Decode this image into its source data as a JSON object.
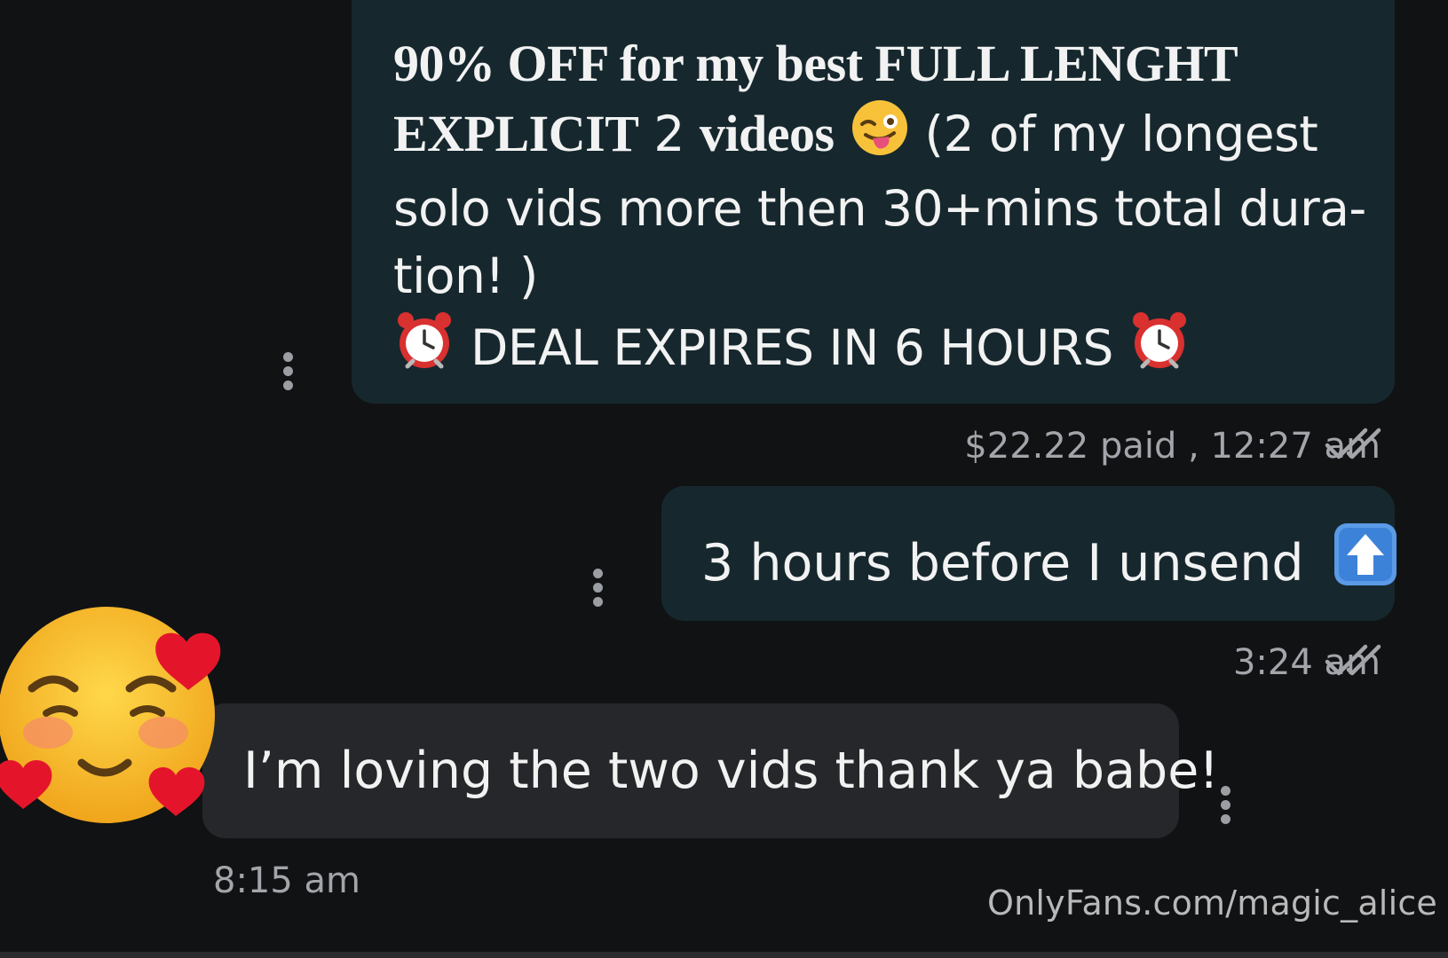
{
  "messages": [
    {
      "direction": "outgoing",
      "line1_bold": "90% OFF for my best FULL LENGHT",
      "line2_bold_a": "EXPLICIT",
      "line2_mid": " 2 ",
      "line2_bold_b": "videos",
      "line2_rest": "(2 of my longest",
      "line3": "solo vids more then 30+mins total dura-",
      "line4": "tion! )",
      "line5": "DEAL EXPIRES IN 6 HOURS",
      "meta": "$22.22 paid , 12:27 am",
      "icons": [
        "winking-tongue-emoji",
        "alarm-clock-emoji",
        "double-check-icon",
        "more-options-icon"
      ]
    },
    {
      "direction": "outgoing",
      "text": "3 hours before I unsend",
      "meta": "3:24 am",
      "icons": [
        "up-arrow-emoji",
        "double-check-icon",
        "more-options-icon"
      ]
    },
    {
      "direction": "incoming",
      "text": "I’m loving the two vids thank ya babe!",
      "meta": "8:15 am",
      "icons": [
        "smiling-face-with-hearts-emoji",
        "more-options-icon"
      ]
    }
  ],
  "watermark": "OnlyFans.com/magic_alice",
  "colors": {
    "background": "#111214",
    "outgoing_bubble": "#16282e",
    "incoming_bubble": "#25272a",
    "meta_text": "#a3a5aa"
  }
}
